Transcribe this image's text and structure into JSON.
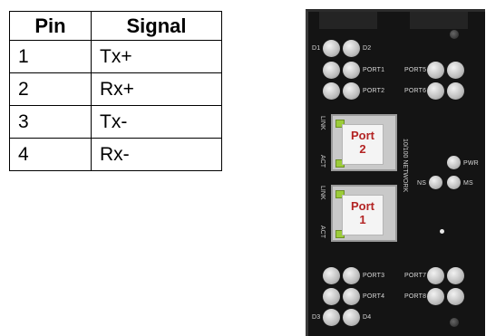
{
  "pin_table": {
    "headers": [
      "Pin",
      "Signal"
    ],
    "rows": [
      {
        "pin": "1",
        "signal": "Tx+"
      },
      {
        "pin": "2",
        "signal": "Rx+"
      },
      {
        "pin": "3",
        "signal": "Tx-"
      },
      {
        "pin": "4",
        "signal": "Rx-"
      }
    ]
  },
  "panel": {
    "labels": {
      "d1": "D1",
      "d2": "D2",
      "d3": "D3",
      "d4": "D4",
      "port1": "PORT1",
      "port2": "PORT2",
      "port3": "PORT3",
      "port4": "PORT4",
      "port5": "PORT5",
      "port6": "PORT6",
      "port7": "PORT7",
      "port8": "PORT8",
      "pwr": "PWR",
      "ns": "NS",
      "ms": "MS",
      "link_top": "LINK",
      "act_top": "ACT",
      "link_bottom": "LINK",
      "act_bottom": "ACT",
      "network": "10/100 NETWORK"
    },
    "ports": [
      {
        "name": "Port",
        "number": "2"
      },
      {
        "name": "Port",
        "number": "1"
      }
    ],
    "colors": {
      "panel_bg": "#141414",
      "port_label": "#b32424",
      "indicator": "#9ccc3a"
    }
  }
}
